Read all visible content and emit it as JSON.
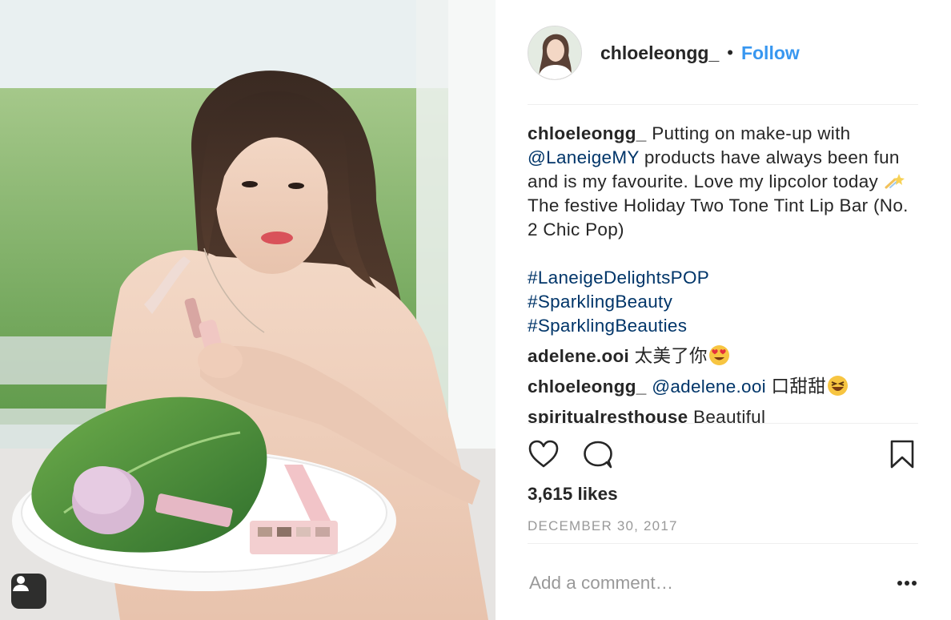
{
  "post": {
    "username": "chloeleongg_",
    "follow_label": "Follow",
    "header_separator": "•"
  },
  "caption": {
    "username": "chloeleongg_",
    "text_1": "Putting on make-up with",
    "mention": "@LaneigeMY",
    "text_2": "products have always been fun and is my favourite. Love my lipcolor today",
    "emoji_1": "dizzy-emoji",
    "text_3": "The festive Holiday Two Tone Tint Lip Bar (No. 2 Chic Pop)",
    "hashtags": [
      "#LaneigeDelightsPOP",
      "#SparklingBeauty",
      "#SparklingBeauties"
    ]
  },
  "comments": [
    {
      "username": "adelene.ooi",
      "text": "太美了你",
      "emoji": "heart-eyes-emoji"
    },
    {
      "username": "chloeleongg_",
      "mention": "@adelene.ooi",
      "text": "口甜甜",
      "emoji": "laughing-emoji"
    },
    {
      "username": "spiritualresthouse",
      "text": "Beautiful"
    }
  ],
  "actions": {
    "like_icon": "heart-outline-icon",
    "comment_icon": "comment-bubble-icon",
    "save_icon": "bookmark-icon"
  },
  "likes": "3,615 likes",
  "date": "DECEMBER 30, 2017",
  "comment_input": {
    "placeholder": "Add a comment…"
  },
  "more_icon": "more-options-icon",
  "photo": {
    "tag_icon": "user-tag-icon"
  },
  "colors": {
    "link_blue": "#3897f0",
    "hashtag_navy": "#003569",
    "meta_gray": "#999999"
  }
}
